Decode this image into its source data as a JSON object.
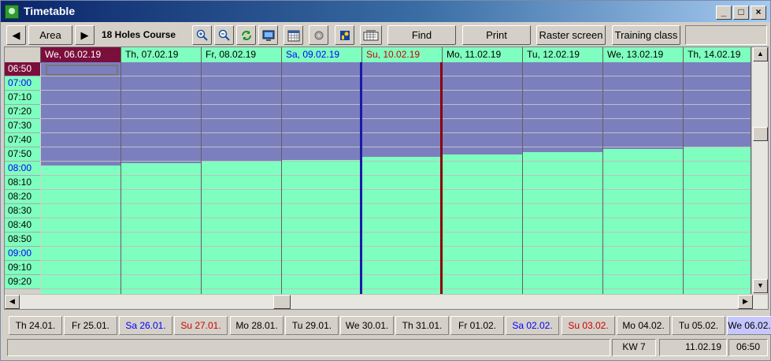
{
  "window": {
    "title": "Timetable"
  },
  "toolbar": {
    "area_label": "Area",
    "course_name": "18 Holes Course",
    "find_label": "Find",
    "print_label": "Print",
    "raster_label": "Raster screen",
    "training_label": "Training class"
  },
  "grid": {
    "days": [
      {
        "label": "We, 06.02.19",
        "color": "#ffffff",
        "selected": true,
        "blocked_slots": 7.3,
        "sep": ""
      },
      {
        "label": "Th, 07.02.19",
        "color": "#000000",
        "selected": false,
        "blocked_slots": 7.1,
        "sep": ""
      },
      {
        "label": "Fr, 08.02.19",
        "color": "#000000",
        "selected": false,
        "blocked_slots": 7.0,
        "sep": ""
      },
      {
        "label": "Sa, 09.02.19",
        "color": "#0000ff",
        "selected": false,
        "blocked_slots": 6.9,
        "sep": "sat"
      },
      {
        "label": "Su, 10.02.19",
        "color": "#cc0000",
        "selected": false,
        "blocked_slots": 6.65,
        "sep": "sun"
      },
      {
        "label": "Mo, 11.02.19",
        "color": "#000000",
        "selected": false,
        "blocked_slots": 6.5,
        "sep": ""
      },
      {
        "label": "Tu, 12.02.19",
        "color": "#000000",
        "selected": false,
        "blocked_slots": 6.35,
        "sep": ""
      },
      {
        "label": "We, 13.02.19",
        "color": "#000000",
        "selected": false,
        "blocked_slots": 6.1,
        "sep": ""
      },
      {
        "label": "Th, 14.02.19",
        "color": "#000000",
        "selected": false,
        "blocked_slots": 6.0,
        "sep": ""
      }
    ],
    "times": [
      {
        "label": "06:50",
        "color": "#ffffff",
        "selected": true
      },
      {
        "label": "07:00",
        "color": "#0000ff",
        "selected": false
      },
      {
        "label": "07:10",
        "color": "#000000",
        "selected": false
      },
      {
        "label": "07:20",
        "color": "#000000",
        "selected": false
      },
      {
        "label": "07:30",
        "color": "#000000",
        "selected": false
      },
      {
        "label": "07:40",
        "color": "#000000",
        "selected": false
      },
      {
        "label": "07:50",
        "color": "#000000",
        "selected": false
      },
      {
        "label": "08:00",
        "color": "#0000ff",
        "selected": false
      },
      {
        "label": "08:10",
        "color": "#000000",
        "selected": false
      },
      {
        "label": "08:20",
        "color": "#000000",
        "selected": false
      },
      {
        "label": "08:30",
        "color": "#000000",
        "selected": false
      },
      {
        "label": "08:40",
        "color": "#000000",
        "selected": false
      },
      {
        "label": "08:50",
        "color": "#000000",
        "selected": false
      },
      {
        "label": "09:00",
        "color": "#0000ff",
        "selected": false
      },
      {
        "label": "09:10",
        "color": "#000000",
        "selected": false
      },
      {
        "label": "09:20",
        "color": "#000000",
        "selected": false
      }
    ],
    "colors": {
      "free": "#7fffbf",
      "blocked": "#7c7fbe",
      "selected": "#7b0f3c"
    }
  },
  "day_tabs": [
    {
      "label": "Th 24.01.",
      "color": "#000000"
    },
    {
      "label": "Fr 25.01.",
      "color": "#000000"
    },
    {
      "label": "Sa 26.01.",
      "color": "#0000ff"
    },
    {
      "label": "Su 27.01.",
      "color": "#cc0000"
    },
    {
      "label": "Mo 28.01.",
      "color": "#000000"
    },
    {
      "label": "Tu 29.01.",
      "color": "#000000"
    },
    {
      "label": "We 30.01.",
      "color": "#000000"
    },
    {
      "label": "Th 31.01.",
      "color": "#000000"
    },
    {
      "label": "Fr 01.02.",
      "color": "#000000"
    },
    {
      "label": "Sa 02.02.",
      "color": "#0000ff"
    },
    {
      "label": "Su 03.02.",
      "color": "#cc0000"
    },
    {
      "label": "Mo 04.02.",
      "color": "#000000"
    },
    {
      "label": "Tu 05.02.",
      "color": "#000000"
    },
    {
      "label": "We 06.02.",
      "color": "#000000",
      "active": true
    }
  ],
  "status": {
    "week": "KW 7",
    "date": "11.02.19",
    "time": "06:50"
  }
}
